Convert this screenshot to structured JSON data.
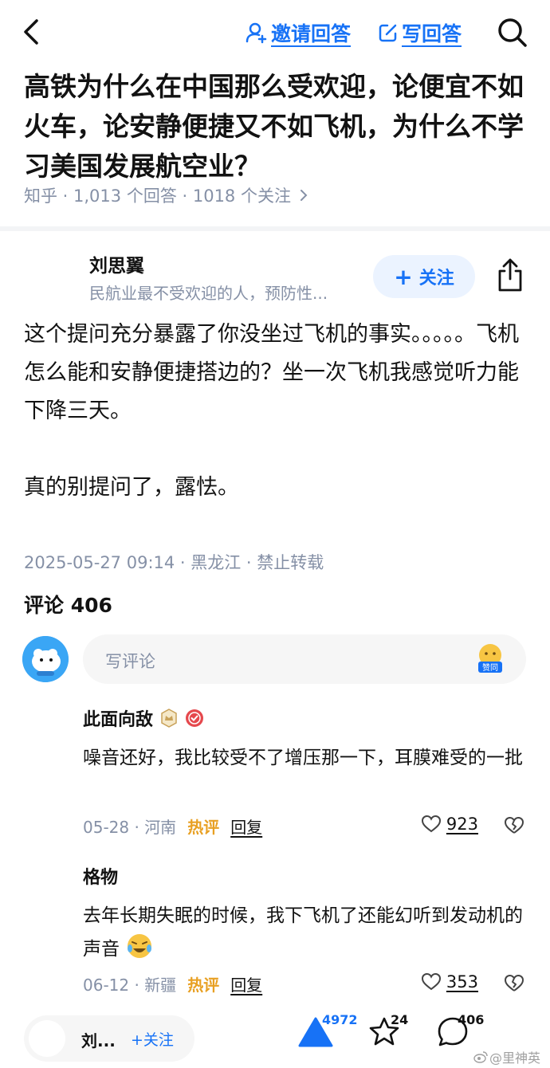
{
  "header": {
    "invite_label": "邀请回答",
    "write_label": "写回答"
  },
  "question": {
    "title": "高铁为什么在中国那么受欢迎，论便宜不如火车，论安静便捷又不如飞机，为什么不学习美国发展航空业？",
    "meta": "知乎 · 1,013 个回答 · 1018 个关注"
  },
  "answer": {
    "author_name": "刘思翼",
    "author_bio": "民航业最不受欢迎的人，预防性...",
    "follow_label": "关注",
    "paragraphs": [
      "这个提问充分暴露了你没坐过飞机的事实。。。。。飞机怎么能和安静便捷搭边的？坐一次飞机我感觉听力能下降三天。",
      "真的别提问了，露怯。"
    ],
    "meta": "2025-05-27 09:14 · 黑龙江 · 禁止转载"
  },
  "comments_section": {
    "title": "评论 406",
    "input_placeholder": "写评论",
    "sticker_label": "赞同",
    "items": [
      {
        "user": "此面向敌",
        "text": "噪音还好，我比较受不了增压那一下，耳膜难受的一批",
        "date_loc": "05-28 · 河南",
        "hot_label": "热评",
        "reply_label": "回复",
        "likes": "923"
      },
      {
        "user": "格物",
        "text": "去年长期失眠的时候，我下飞机了还能幻听到发动机的声音",
        "date_loc": "06-12 · 新疆",
        "hot_label": "热评",
        "reply_label": "回复",
        "likes": "353"
      }
    ]
  },
  "bottom_bar": {
    "author_name": "刘...",
    "follow_label": "+关注",
    "upvotes": "4972",
    "favorites": "24",
    "comments": "406"
  },
  "watermark": "@里神英",
  "colors": {
    "accent": "#1772f6",
    "hot": "#e8a023",
    "meta_gray": "#8590a6"
  }
}
